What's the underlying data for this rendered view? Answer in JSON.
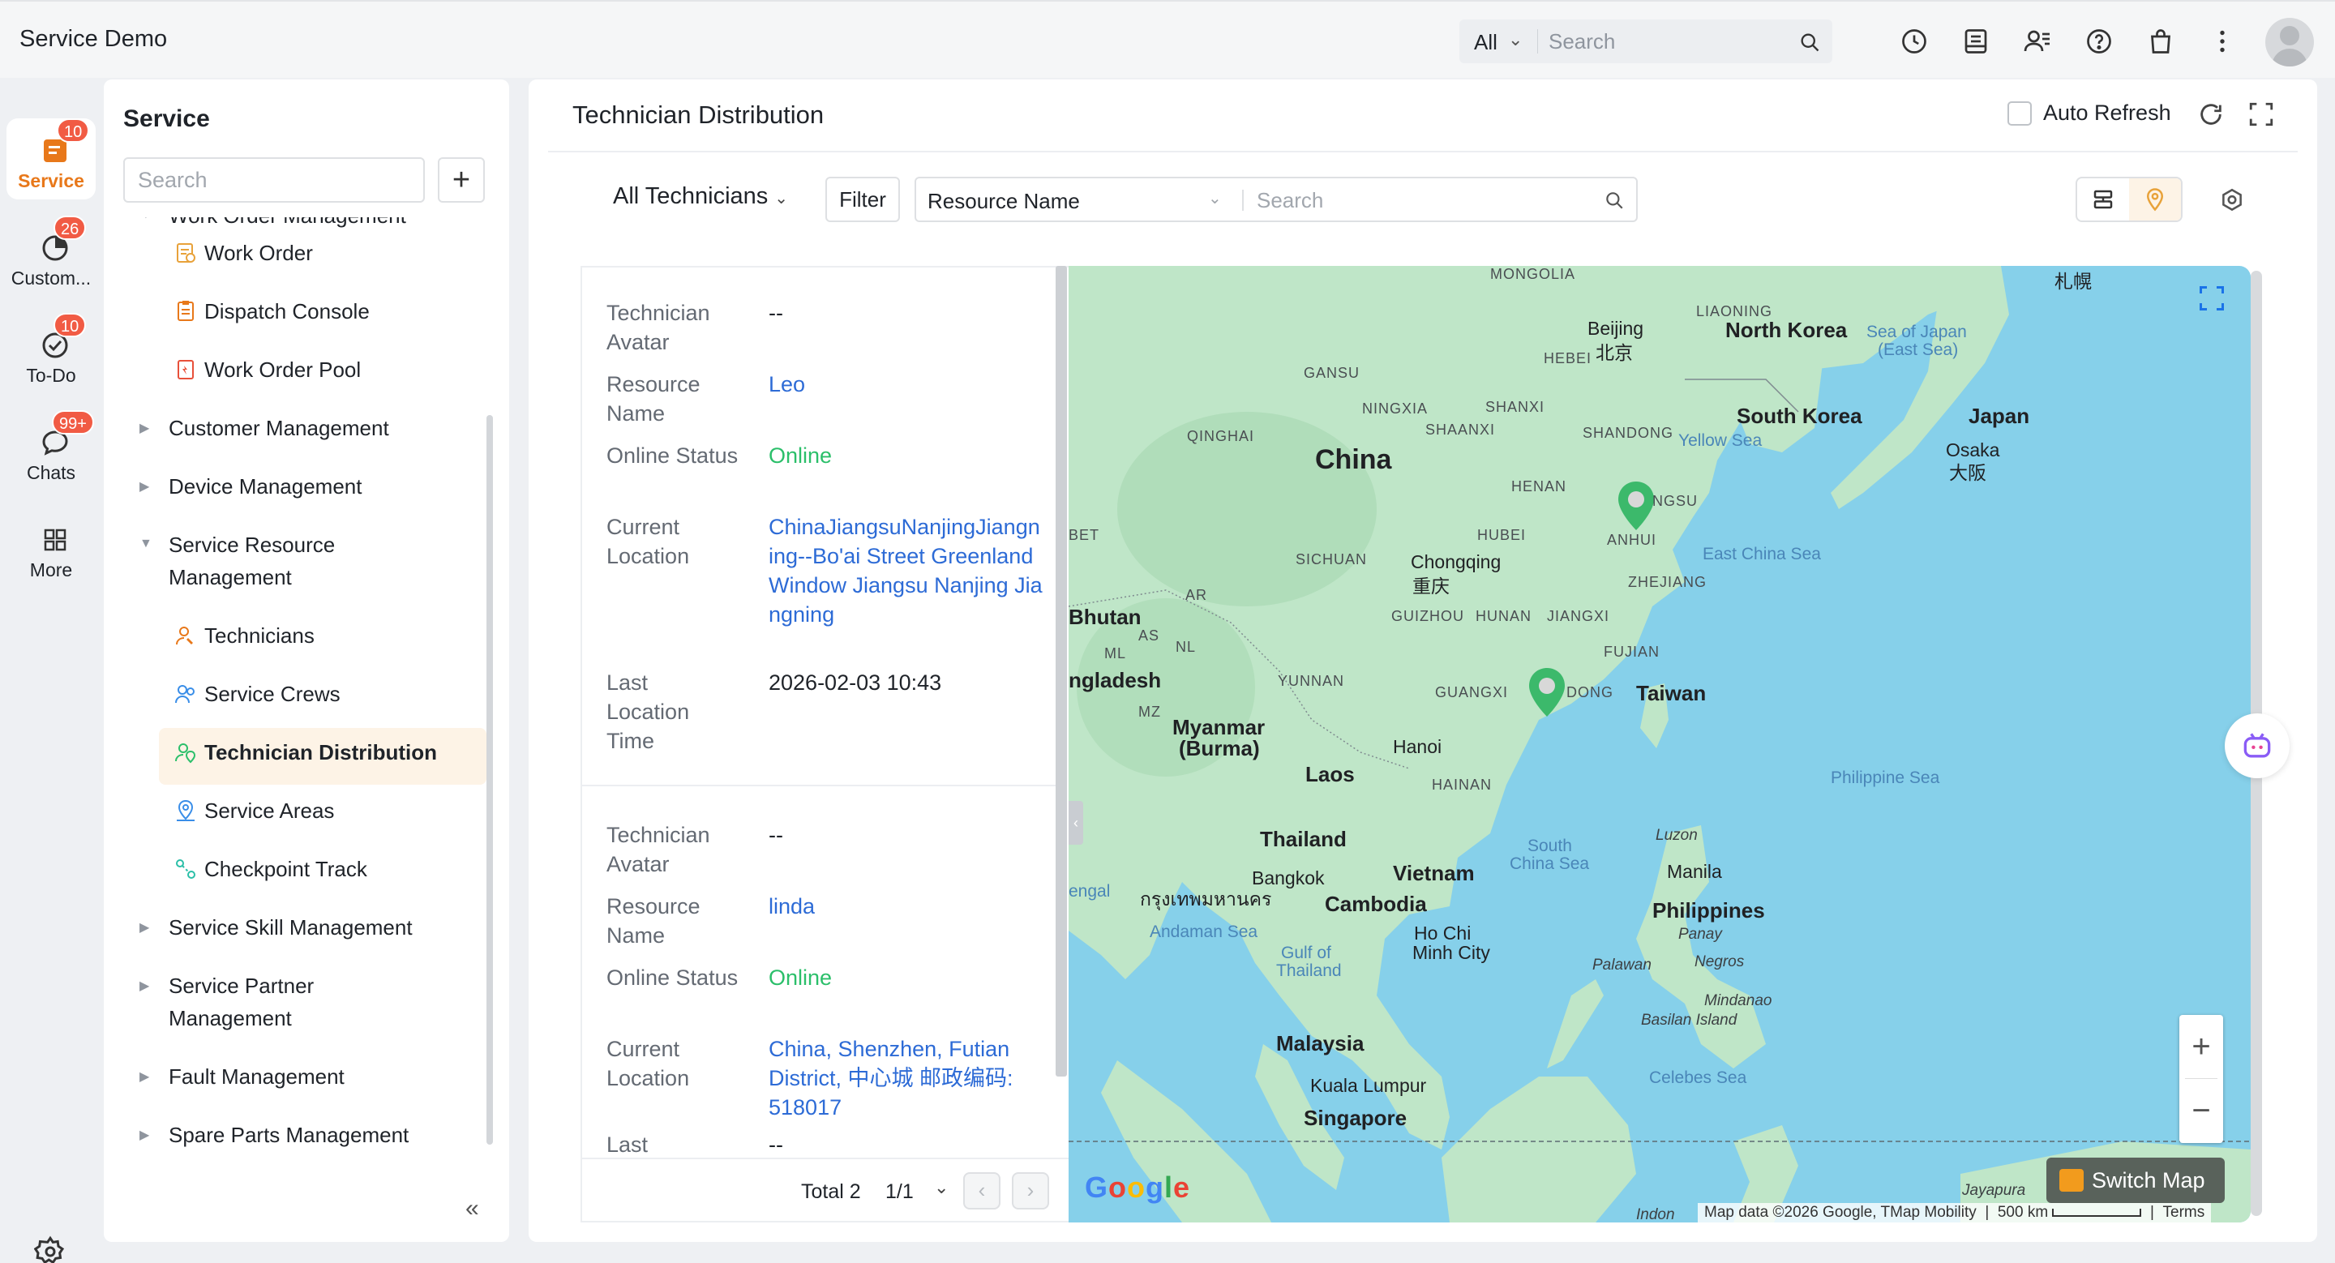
{
  "app": {
    "title": "Service Demo"
  },
  "topbar": {
    "search_scope": "All",
    "search_placeholder": "Search",
    "icons": [
      "history-icon",
      "notes-icon",
      "contacts-icon",
      "help-icon",
      "store-icon",
      "more-vertical-icon"
    ]
  },
  "rail": {
    "items": [
      {
        "label": "Service",
        "badge": "10",
        "icon": "service-icon",
        "active": true
      },
      {
        "label": "Custom...",
        "badge": "26",
        "icon": "customer-icon"
      },
      {
        "label": "To-Do",
        "badge": "10",
        "icon": "todo-icon"
      },
      {
        "label": "Chats",
        "badge": "99+",
        "icon": "chats-icon"
      },
      {
        "label": "More",
        "icon": "grid-icon"
      }
    ]
  },
  "nav": {
    "title": "Service",
    "search_placeholder": "Search",
    "partial_item": "Work Order Management",
    "work_order_children": [
      "Work Order",
      "Dispatch Console",
      "Work Order Pool"
    ],
    "groups": {
      "customer": "Customer Management",
      "device": "Device Management",
      "resource_line1": "Service Resource",
      "resource_line2": "Management",
      "skill": "Service Skill Management",
      "partner_line1": "Service Partner",
      "partner_line2": "Management",
      "fault": "Fault Management",
      "spare": "Spare Parts Management"
    },
    "resource_children": [
      "Technicians",
      "Service Crews",
      "Technician Distribution",
      "Service Areas",
      "Checkpoint Track"
    ],
    "active_item": "Technician Distribution"
  },
  "main": {
    "title": "Technician Distribution",
    "auto_refresh_label": "Auto Refresh",
    "scope_dropdown": "All Technicians",
    "filter_label": "Filter",
    "field_select": "Resource Name",
    "search_placeholder": "Search"
  },
  "list": {
    "labels": {
      "avatar": "Technician Avatar",
      "name": "Resource Name",
      "status": "Online Status",
      "location": "Current Location",
      "time": "Last Location Time"
    },
    "technicians": [
      {
        "avatar": "--",
        "name": "Leo",
        "status": "Online",
        "location": "ChinaJiangsuNanjingJiangning--Bo'ai Street Greenland Window Jiangsu Nanjing Jiangning",
        "time": "2026-02-03 10:43"
      },
      {
        "avatar": "--",
        "name": "linda",
        "status": "Online",
        "location": "China, Shenzhen, Futian District, 中心城 邮政编码: 518017",
        "time": "--"
      }
    ],
    "pager": {
      "total": "Total 2",
      "page": "1/1"
    }
  },
  "map": {
    "switch_label": "Switch Map",
    "attribution": "Map data ©2026 Google, TMap Mobility",
    "scale": "500 km",
    "terms": "Terms",
    "google": "Google",
    "labels": {
      "countries": [
        "China",
        "North Korea",
        "South Korea",
        "Japan",
        "Taiwan",
        "Bhutan",
        "ngladesh",
        "Myanmar",
        "(Burma)",
        "Laos",
        "Thailand",
        "Vietnam",
        "Cambodia",
        "Philippines",
        "Malaysia",
        "Singapore"
      ],
      "seas": [
        "Sea of Japan",
        "(East Sea)",
        "Yellow Sea",
        "East China Sea",
        "South",
        "China Sea",
        "Philippine Sea",
        "Andaman Sea",
        "Gulf of",
        "Thailand",
        "Celebes Sea",
        "engal"
      ],
      "provinces": [
        "MONGOLIA",
        "LIAONING",
        "HEBEI",
        "GANSU",
        "NINGXIA",
        "SHANXI",
        "QINGHAI",
        "SHAANXI",
        "SHANDONG",
        "HENAN",
        "NGSU",
        "ANHUI",
        "HUBEI",
        "SICHUAN",
        "ZHEJIANG",
        "GUIZHOU",
        "HUNAN",
        "JIANGXI",
        "FUJIAN",
        "YUNNAN",
        "GUANGXI",
        "DONG",
        "HAINAN",
        "BET",
        "AR",
        "AS",
        "ML",
        "NL",
        "MZ"
      ],
      "cities": [
        "Beijing",
        "北京",
        "Osaka",
        "大阪",
        "Chongqing",
        "重庆",
        "Hanoi",
        "Bangkok",
        "กรุงเทพมหานคร",
        "Ho Chi",
        "Minh City",
        "Manila",
        "Kuala Lumpur",
        "札幌",
        "Jayapura"
      ],
      "islands": [
        "Luzon",
        "Panay",
        "Palawan",
        "Negros",
        "Mindanao",
        "Basilan Island",
        "Indon"
      ]
    }
  },
  "colors": {
    "accent": "#e8781a",
    "badge": "#f15b44",
    "link": "#2d6bd6",
    "online": "#2bbf6a",
    "water": "#7ecde8",
    "land": "#b9e5c7",
    "pin": "#3cb96b"
  }
}
